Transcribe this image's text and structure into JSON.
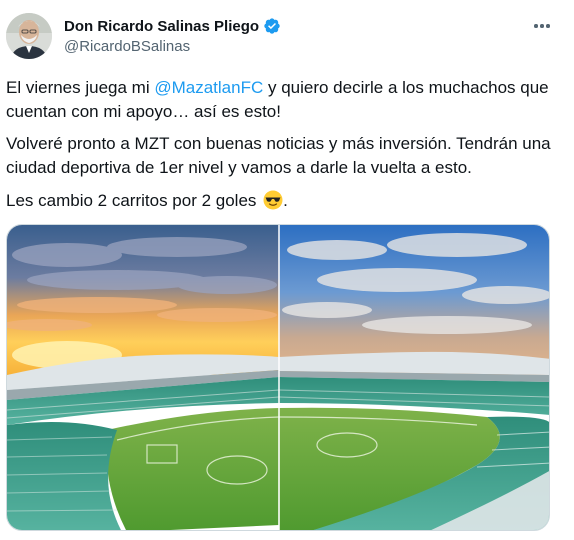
{
  "tweet": {
    "author": {
      "display_name": "Don Ricardo Salinas Pliego",
      "handle": "@RicardoBSalinas",
      "verified": true
    },
    "text": {
      "line1_pre": "El viernes juega mi ",
      "mention": "@MazatlanFC",
      "line1_post": " y quiero decirle a los muchachos que cuentan con mi apoyo… así es esto!",
      "para2": "Volveré pronto a MZT con buenas noticias y más inversión. Tendrán una ciudad deportiva de 1er nivel y vamos a darle la vuelta a esto.",
      "para3": "Les cambio 2 carritos por 2 goles",
      "para3_end": "."
    },
    "emoji_icon": "sunglasses-face",
    "media_description_icon": "stadium-photo"
  },
  "colors": {
    "accent": "#1d9bf0",
    "text": "#0f1419",
    "secondary": "#536471"
  }
}
